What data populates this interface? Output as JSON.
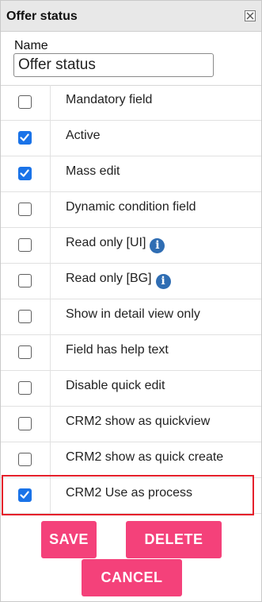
{
  "panel": {
    "title": "Offer status",
    "close_icon": "close-x-icon"
  },
  "name": {
    "label": "Name",
    "value": "Offer status"
  },
  "rows": [
    {
      "label": "Mandatory field",
      "checked": false,
      "info": false
    },
    {
      "label": "Active",
      "checked": true,
      "info": false
    },
    {
      "label": "Mass edit",
      "checked": true,
      "info": false
    },
    {
      "label": "Dynamic condition field",
      "checked": false,
      "info": false
    },
    {
      "label": "Read only [UI]",
      "checked": false,
      "info": true
    },
    {
      "label": "Read only [BG]",
      "checked": false,
      "info": true
    },
    {
      "label": "Show in detail view only",
      "checked": false,
      "info": false
    },
    {
      "label": "Field has help text",
      "checked": false,
      "info": false
    },
    {
      "label": "Disable quick edit",
      "checked": false,
      "info": false
    },
    {
      "label": "CRM2 show as quickview",
      "checked": false,
      "info": false
    },
    {
      "label": "CRM2 show as quick create",
      "checked": false,
      "info": false
    },
    {
      "label": "CRM2 Use as process",
      "checked": true,
      "info": false,
      "highlighted": true
    }
  ],
  "info_icon_glyph": "i",
  "buttons": {
    "save": "SAVE",
    "delete": "DELETE",
    "cancel": "CANCEL"
  },
  "colors": {
    "checkbox_checked": "#1a73e8",
    "button": "#f4417a",
    "highlight_border": "#e5202b",
    "info_icon": "#2f6db3"
  }
}
